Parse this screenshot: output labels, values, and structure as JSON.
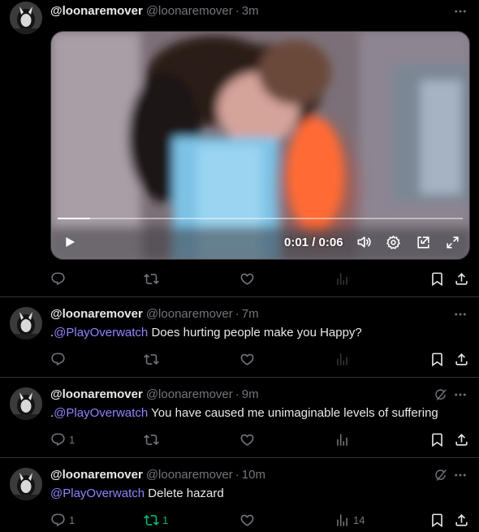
{
  "tweets": [
    {
      "display_name": "@loonaremover",
      "handle": "@loonaremover",
      "separator": "·",
      "time": "3m",
      "has_video": true,
      "video": {
        "current_time": "0:01",
        "divider": "/",
        "duration": "0:06",
        "progress": 0.08
      },
      "actions": {
        "replies": "",
        "reposts": "",
        "likes": "",
        "views": ""
      }
    },
    {
      "display_name": "@loonaremover",
      "handle": "@loonaremover",
      "separator": "·",
      "time": "7m",
      "text_prefix": ".",
      "mention": "@PlayOverwatch",
      "text_body": " Does hurting people make you Happy?",
      "actions": {
        "replies": "",
        "reposts": "",
        "likes": "",
        "views": ""
      }
    },
    {
      "display_name": "@loonaremover",
      "handle": "@loonaremover",
      "separator": "·",
      "time": "9m",
      "text_prefix": ".",
      "mention": "@PlayOverwatch",
      "text_body": " You have caused me unimaginable levels of suffering",
      "actions": {
        "replies": "1",
        "reposts": "",
        "likes": "",
        "views": ""
      }
    },
    {
      "display_name": "@loonaremover",
      "handle": "@loonaremover",
      "separator": "·",
      "time": "10m",
      "text_prefix": "",
      "mention": "@PlayOverwatch",
      "text_body": " Delete hazard",
      "actions": {
        "replies": "1",
        "reposts": "1",
        "likes": "",
        "views": "14"
      }
    }
  ],
  "colors": {
    "background": "#000000",
    "text": "#e7e9ea",
    "muted": "#71767b",
    "mention": "#8f84ff",
    "repost_active": "#00ba7c",
    "divider": "#2f3336"
  },
  "icons": [
    "avatar",
    "more-icon",
    "grok-icon",
    "play-icon",
    "volume-icon",
    "settings-icon",
    "pip-icon",
    "fullscreen-icon",
    "reply-icon",
    "repost-icon",
    "like-icon",
    "views-icon",
    "bookmark-icon",
    "share-icon"
  ]
}
